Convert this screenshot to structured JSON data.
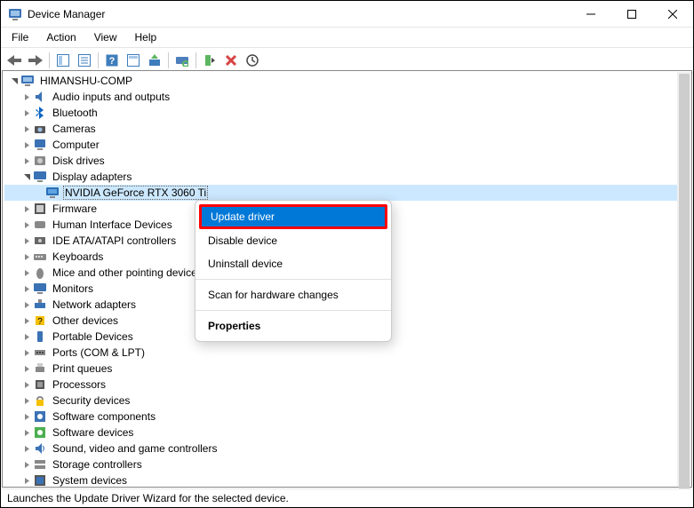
{
  "window": {
    "title": "Device Manager"
  },
  "menu": {
    "items": [
      "File",
      "Action",
      "View",
      "Help"
    ]
  },
  "tree": {
    "root": {
      "label": "HIMANSHU-COMP",
      "expanded": true
    },
    "categories": [
      {
        "label": "Audio inputs and outputs",
        "expanded": false
      },
      {
        "label": "Bluetooth",
        "expanded": false
      },
      {
        "label": "Cameras",
        "expanded": false
      },
      {
        "label": "Computer",
        "expanded": false
      },
      {
        "label": "Disk drives",
        "expanded": false
      },
      {
        "label": "Display adapters",
        "expanded": true,
        "children": [
          {
            "label": "NVIDIA GeForce RTX 3060 Ti",
            "selected": true
          }
        ]
      },
      {
        "label": "Firmware",
        "expanded": false
      },
      {
        "label": "Human Interface Devices",
        "expanded": false
      },
      {
        "label": "IDE ATA/ATAPI controllers",
        "expanded": false
      },
      {
        "label": "Keyboards",
        "expanded": false
      },
      {
        "label": "Mice and other pointing devices",
        "expanded": false
      },
      {
        "label": "Monitors",
        "expanded": false
      },
      {
        "label": "Network adapters",
        "expanded": false
      },
      {
        "label": "Other devices",
        "expanded": false
      },
      {
        "label": "Portable Devices",
        "expanded": false
      },
      {
        "label": "Ports (COM & LPT)",
        "expanded": false
      },
      {
        "label": "Print queues",
        "expanded": false
      },
      {
        "label": "Processors",
        "expanded": false
      },
      {
        "label": "Security devices",
        "expanded": false
      },
      {
        "label": "Software components",
        "expanded": false
      },
      {
        "label": "Software devices",
        "expanded": false
      },
      {
        "label": "Sound, video and game controllers",
        "expanded": false
      },
      {
        "label": "Storage controllers",
        "expanded": false
      },
      {
        "label": "System devices",
        "expanded": false
      }
    ]
  },
  "context_menu": {
    "items": [
      {
        "label": "Update driver",
        "highlighted": true
      },
      {
        "label": "Disable device"
      },
      {
        "label": "Uninstall device"
      },
      {
        "sep": true
      },
      {
        "label": "Scan for hardware changes"
      },
      {
        "sep": true
      },
      {
        "label": "Properties",
        "bold": true
      }
    ]
  },
  "status": {
    "text": "Launches the Update Driver Wizard for the selected device."
  }
}
